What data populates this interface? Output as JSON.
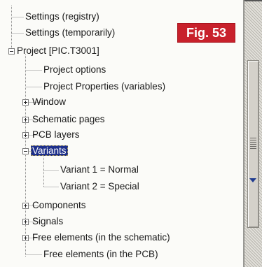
{
  "figure_label": "Fig. 53",
  "tree": {
    "items": [
      {
        "label": "Settings (registry)"
      },
      {
        "label": "Settings (temporarily)"
      },
      {
        "label": "Project [PIC.T3001]",
        "expanded": true
      },
      {
        "label": "Project options"
      },
      {
        "label": "Project Properties (variables)"
      },
      {
        "label": "Window",
        "expanded": false
      },
      {
        "label": "Schematic pages",
        "expanded": false
      },
      {
        "label": "PCB layers",
        "expanded": false
      },
      {
        "label": "Variants",
        "expanded": true,
        "selected": true
      },
      {
        "label": "Variant 1 = Normal"
      },
      {
        "label": "Variant 2 = Special"
      },
      {
        "label": "Components",
        "expanded": false
      },
      {
        "label": "Signals",
        "expanded": false
      },
      {
        "label": "Free elements (in the schematic)",
        "expanded": false
      },
      {
        "label": "Free elements (in the PCB)"
      }
    ]
  },
  "colors": {
    "selection": "#1d2f8a",
    "badge": "#c8202b",
    "tree_background": "#fbfbf8"
  }
}
